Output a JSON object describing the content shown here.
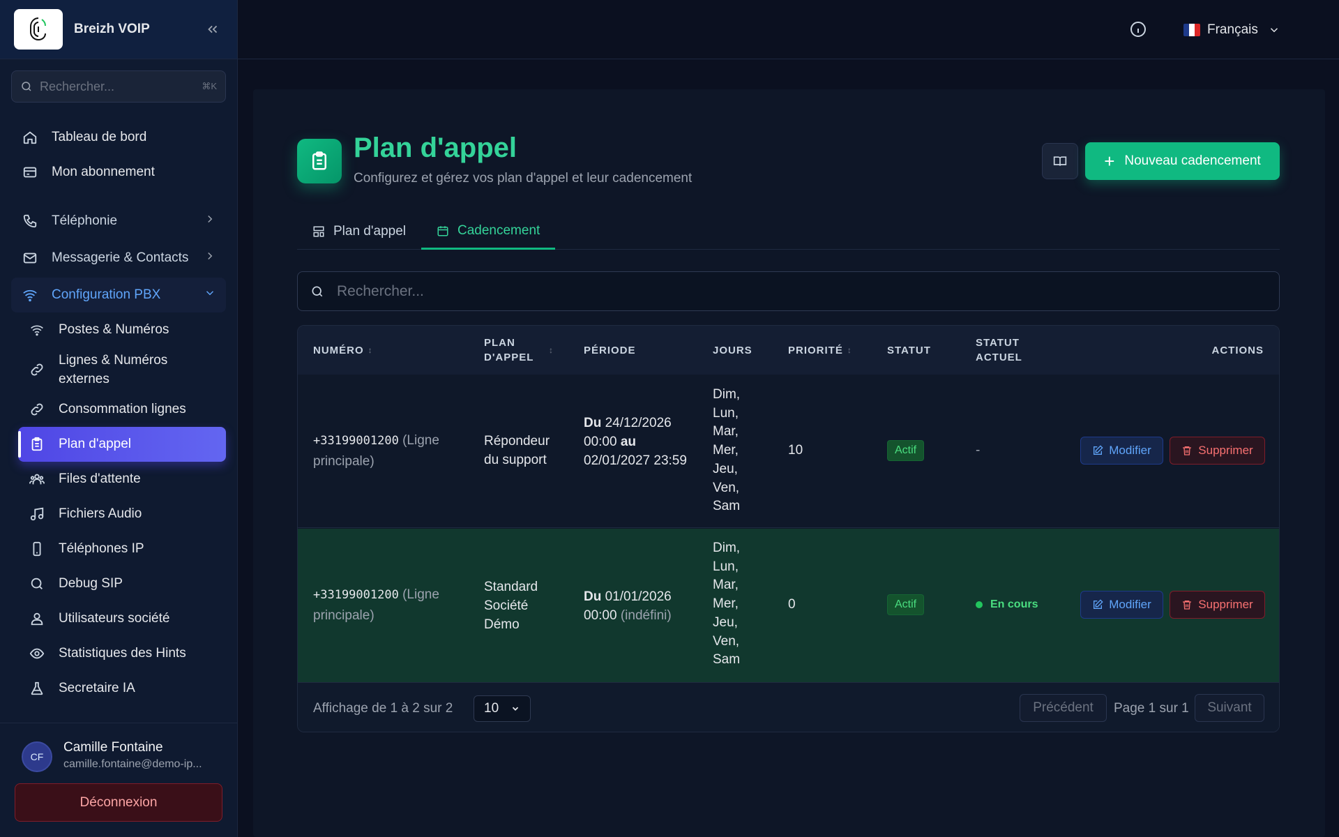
{
  "brand": {
    "name": "Breizh VOIP"
  },
  "sidebar_search": {
    "placeholder": "Rechercher...",
    "shortcut": "⌘K"
  },
  "nav": {
    "dashboard": "Tableau de bord",
    "subscription": "Mon abonnement",
    "telephony": "Téléphonie",
    "messaging": "Messagerie & Contacts",
    "pbx": "Configuration PBX",
    "pbx_items": {
      "postes": "Postes & Numéros",
      "lignes": "Lignes & Numéros externes",
      "consommation": "Consommation lignes",
      "plan": "Plan d'appel",
      "files": "Files d'attente",
      "audio": "Fichiers Audio",
      "phones": "Téléphones IP",
      "debug": "Debug SIP",
      "users": "Utilisateurs société",
      "stats": "Statistiques des Hints",
      "ai": "Secretaire IA"
    }
  },
  "user": {
    "initials": "CF",
    "name": "Camille Fontaine",
    "email": "camille.fontaine@demo-ip...",
    "logout": "Déconnexion"
  },
  "topbar": {
    "language": "Français"
  },
  "page": {
    "title": "Plan d'appel",
    "subtitle": "Configurez et gérez vos plan d'appel et leur cadencement",
    "new_button": "Nouveau cadencement"
  },
  "tabs": {
    "plan": "Plan d'appel",
    "cadencement": "Cadencement"
  },
  "search": {
    "placeholder": "Rechercher..."
  },
  "table": {
    "headers": {
      "numero": "NUMÉRO",
      "plan": "PLAN D'APPEL",
      "periode": "PÉRIODE",
      "jours": "JOURS",
      "priorite": "PRIORITÉ",
      "statut": "STATUT",
      "statut_actuel": "STATUT ACTUEL",
      "actions": "ACTIONS"
    },
    "rows": [
      {
        "numero": "+33199001200",
        "ligne": "(Ligne principale)",
        "plan": "Répondeur du support",
        "du": "Du",
        "date1": "24/12/2026 00:00",
        "au": "au",
        "date2": "02/01/2027 23:59",
        "jours": "Dim, Lun, Mar, Mer, Jeu, Ven, Sam",
        "priorite": "10",
        "statut": "Actif",
        "statut_actuel": "-",
        "modifier": "Modifier",
        "supprimer": "Supprimer"
      },
      {
        "numero": "+33199001200",
        "ligne": "(Ligne principale)",
        "plan": "Standard Société Démo",
        "du": "Du",
        "date1": "01/01/2026 00:00",
        "indefini": "(indéfini)",
        "jours": "Dim, Lun, Mar, Mer, Jeu, Ven, Sam",
        "priorite": "0",
        "statut": "Actif",
        "statut_actuel": "En cours",
        "modifier": "Modifier",
        "supprimer": "Supprimer"
      }
    ]
  },
  "footer": {
    "showing": "Affichage de 1 à 2 sur 2",
    "per_page": "10",
    "prev": "Précédent",
    "page_info": "Page 1 sur 1",
    "next": "Suivant"
  },
  "colors": {
    "accent": "#10b981",
    "active_nav": "#4f46e5",
    "highlight_row": "#11382e"
  }
}
